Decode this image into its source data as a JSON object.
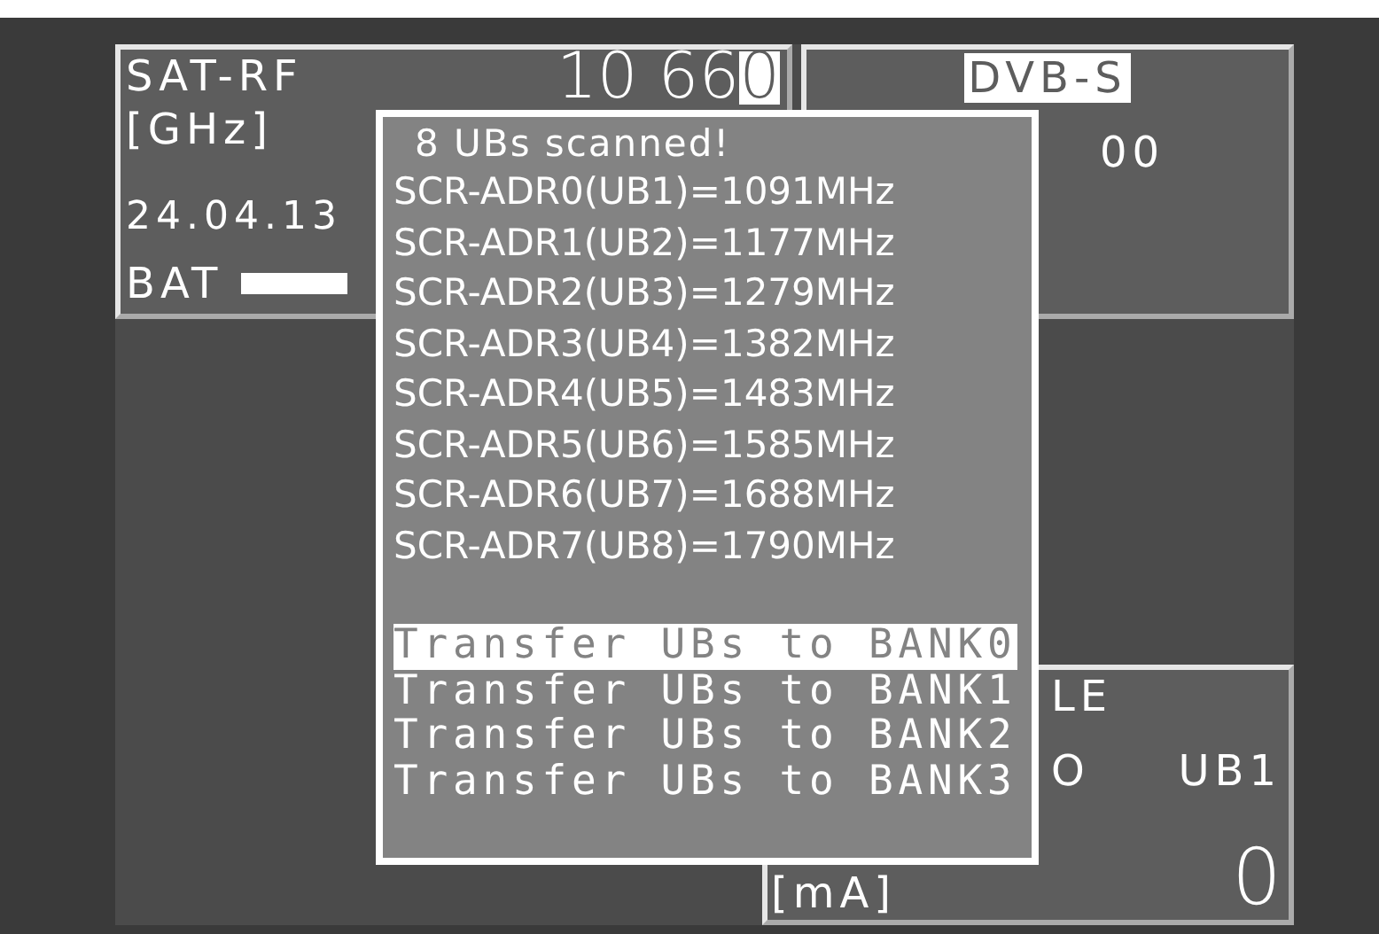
{
  "measurement": {
    "label": "SAT-RF",
    "unit": "[GHz]",
    "value": "10 66",
    "cursor_digit": "0",
    "date": "24.04.13",
    "battery_label": "BAT"
  },
  "standard_panel": {
    "standard": "DVB-S",
    "value": "00"
  },
  "lnb_panel": {
    "line_1": "LE",
    "line_2": "O",
    "band": "UB1",
    "unit": "[mA]",
    "value": "0"
  },
  "popup": {
    "title": "8 UBs scanned!",
    "results": [
      "SCR-ADR0(UB1)=1091MHz",
      "SCR-ADR1(UB2)=1177MHz",
      "SCR-ADR2(UB3)=1279MHz",
      "SCR-ADR3(UB4)=1382MHz",
      "SCR-ADR4(UB5)=1483MHz",
      "SCR-ADR5(UB6)=1585MHz",
      "SCR-ADR6(UB7)=1688MHz",
      "SCR-ADR7(UB8)=1790MHz"
    ],
    "actions": [
      {
        "label": "Transfer UBs to BANK0",
        "selected": true
      },
      {
        "label": "Transfer UBs to BANK1",
        "selected": false
      },
      {
        "label": "Transfer UBs to BANK2",
        "selected": false
      },
      {
        "label": "Transfer UBs to BANK3",
        "selected": false
      }
    ]
  }
}
